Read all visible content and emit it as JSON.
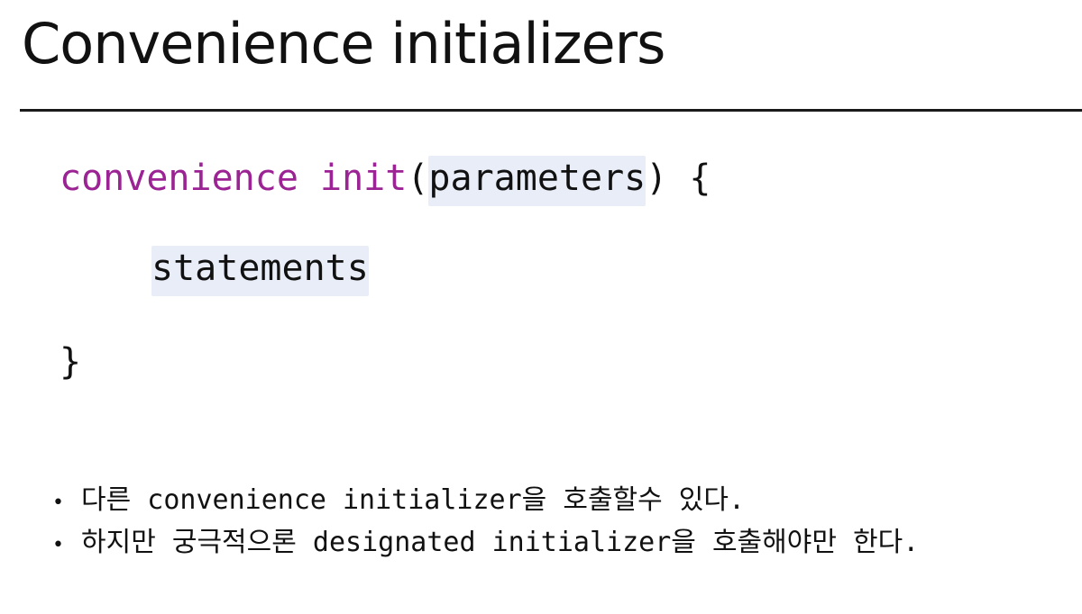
{
  "slide": {
    "title": "Convenience initializers"
  },
  "code": {
    "keyword_convenience": "convenience",
    "space": " ",
    "keyword_init": "init",
    "open_paren": "(",
    "param_placeholder": "parameters",
    "close_paren_brace": ") {",
    "statements_placeholder": "statements",
    "closing_brace": "}",
    "keyword_color": "#9b2393",
    "placeholder_bg": "#e8edf7"
  },
  "bullets": {
    "marker": "•",
    "items": [
      "다른 convenience initializer을 호출할수 있다.",
      "하지만 궁극적으론 designated initializer을 호출해야만 한다."
    ]
  }
}
